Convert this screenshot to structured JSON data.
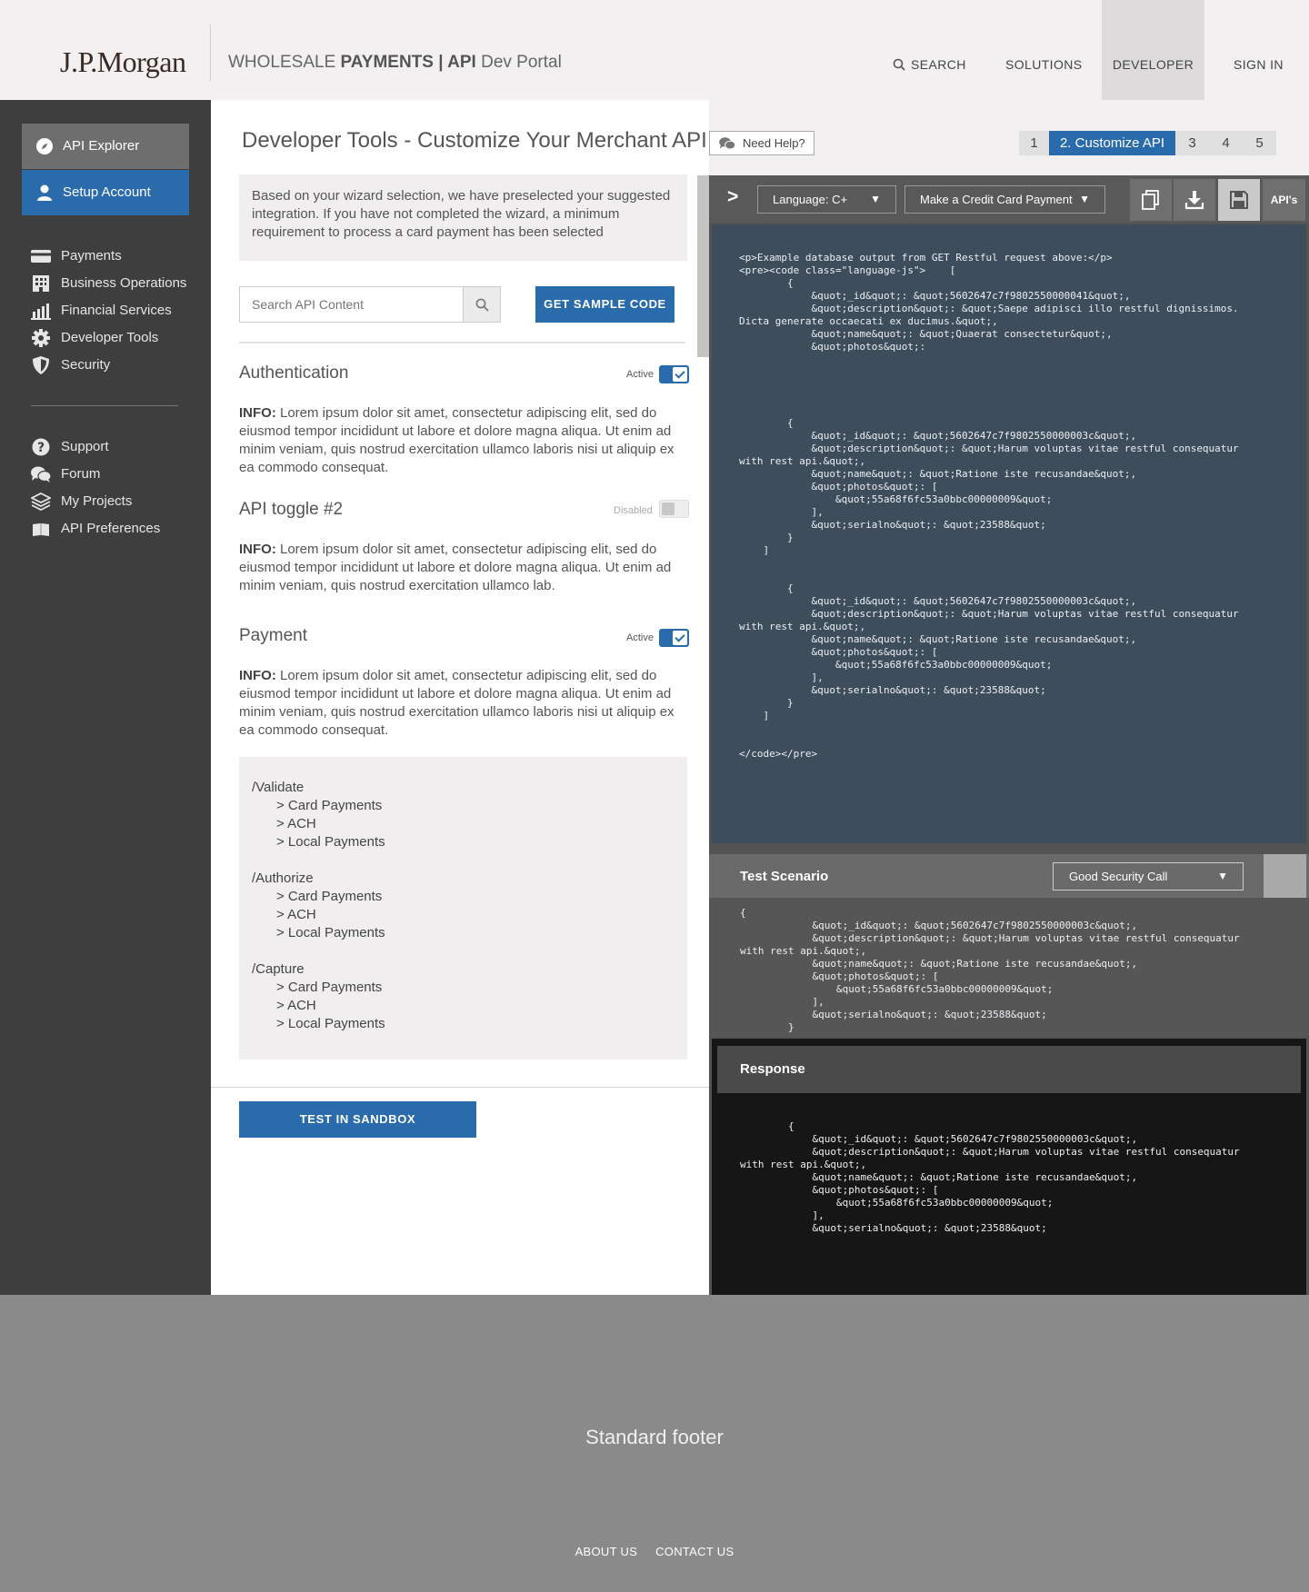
{
  "header": {
    "logo": "J.P.Morgan",
    "portal_pre": "WHOLESALE ",
    "portal_bold1": "PAYMENTS",
    "portal_sep": " | ",
    "portal_bold2": "API",
    "portal_post": " Dev Portal",
    "nav": {
      "search": "SEARCH",
      "solutions": "SOLUTIONS",
      "developer": "DEVELOPER",
      "signin": "SIGN IN"
    }
  },
  "sidebar": {
    "buttons": [
      {
        "label": "API Explorer",
        "icon": "compass-icon"
      },
      {
        "label": "Setup Account",
        "icon": "user-icon"
      }
    ],
    "items": [
      {
        "label": "Payments",
        "icon": "card-icon"
      },
      {
        "label": "Business Operations",
        "icon": "building-icon"
      },
      {
        "label": "Financial Services",
        "icon": "chart-icon"
      },
      {
        "label": "Developer Tools",
        "icon": "gear-icon"
      },
      {
        "label": "Security",
        "icon": "shield-icon"
      }
    ],
    "support_items": [
      {
        "label": "Support",
        "icon": "question-icon"
      },
      {
        "label": "Forum",
        "icon": "chat-icon"
      },
      {
        "label": "My Projects",
        "icon": "layers-icon"
      },
      {
        "label": "API Preferences",
        "icon": "book-icon"
      }
    ]
  },
  "main": {
    "title": "Developer Tools - Customize Your Merchant API",
    "intro": "Based on your wizard selection, we have preselected your suggested integration. If you have not completed the wizard, a minimum requirement to process a card payment has been selected",
    "search_placeholder": "Search API Content",
    "sample_button": "GET SAMPLE CODE",
    "sections": [
      {
        "title": "Authentication",
        "status": "Active",
        "info_label": "INFO:",
        "info": " Lorem ipsum dolor sit amet, consectetur adipiscing elit, sed do eiusmod tempor incididunt ut labore et dolore magna aliqua. Ut enim ad minim veniam, quis nostrud exercitation ullamco laboris nisi ut aliquip ex ea commodo consequat."
      },
      {
        "title": "API toggle #2",
        "status": "Disabled",
        "info_label": "INFO:",
        "info": " Lorem ipsum dolor sit amet, consectetur adipiscing elit, sed do eiusmod tempor incididunt ut labore et dolore magna aliqua. Ut enim ad minim veniam, quis nostrud exercitation ullamco lab."
      },
      {
        "title": "Payment",
        "status": "Active",
        "info_label": "INFO:",
        "info": " Lorem ipsum dolor sit amet, consectetur adipiscing elit, sed do eiusmod tempor incididunt ut labore et dolore magna aliqua. Ut enim ad minim veniam, quis nostrud exercitation ullamco laboris nisi ut aliquip ex ea commodo consequat."
      }
    ],
    "endpoints": [
      {
        "path": "/Validate",
        "items": [
          "> Card Payments",
          "> ACH",
          "> Local Payments"
        ]
      },
      {
        "path": "/Authorize",
        "items": [
          "> Card Payments",
          "> ACH",
          "> Local Payments"
        ]
      },
      {
        "path": "/Capture",
        "items": [
          "> Card Payments",
          "> ACH",
          "> Local Payments"
        ]
      }
    ],
    "sandbox_button": "TEST IN SANDBOX"
  },
  "right": {
    "help": "Need Help?",
    "steps": [
      {
        "label": "1",
        "width": 33
      },
      {
        "label": "2. Customize API",
        "width": 139,
        "active": true
      },
      {
        "label": "3",
        "width": 37
      },
      {
        "label": "4",
        "width": 37
      },
      {
        "label": "5",
        "width": 37
      }
    ],
    "toolbar": {
      "prompt": ">",
      "language": "Language: C+",
      "payment": "Make a Credit Card Payment",
      "apis": "API's"
    },
    "code": "<p>Example database output from GET Restful request above:</p>\n<pre><code class=\"language-js\">    [\n        {\n            &quot;_id&quot;: &quot;5602647c7f9802550000041&quot;,\n            &quot;description&quot;: &quot;Saepe adipisci illo restful dignissimos.\nDicta generate occaecati ex ducimus.&quot;,\n            &quot;name&quot;: &quot;Quaerat consectetur&quot;,\n            &quot;photos&quot;:\n\n\n\n\n\n        {\n            &quot;_id&quot;: &quot;5602647c7f9802550000003c&quot;,\n            &quot;description&quot;: &quot;Harum voluptas vitae restful consequatur\nwith rest api.&quot;,\n            &quot;name&quot;: &quot;Ratione iste recusandae&quot;,\n            &quot;photos&quot;: [\n                &quot;55a68f6fc53a0bbc00000009&quot;\n            ],\n            &quot;serialno&quot;: &quot;23588&quot;\n        }\n    ]\n\n\n        {\n            &quot;_id&quot;: &quot;5602647c7f9802550000003c&quot;,\n            &quot;description&quot;: &quot;Harum voluptas vitae restful consequatur\nwith rest api.&quot;,\n            &quot;name&quot;: &quot;Ratione iste recusandae&quot;,\n            &quot;photos&quot;: [\n                &quot;55a68f6fc53a0bbc00000009&quot;\n            ],\n            &quot;serialno&quot;: &quot;23588&quot;\n        }\n    ]\n\n\n</code></pre>",
    "scenario": {
      "title": "Test Scenario",
      "selected": "Good Security Call",
      "code": "{\n            &quot;_id&quot;: &quot;5602647c7f9802550000003c&quot;,\n            &quot;description&quot;: &quot;Harum voluptas vitae restful consequatur\nwith rest api.&quot;,\n            &quot;name&quot;: &quot;Ratione iste recusandae&quot;,\n            &quot;photos&quot;: [\n                &quot;55a68f6fc53a0bbc00000009&quot;\n            ],\n            &quot;serialno&quot;: &quot;23588&quot;\n        }"
    },
    "response": {
      "title": "Response",
      "code": "        {\n            &quot;_id&quot;: &quot;5602647c7f9802550000003c&quot;,\n            &quot;description&quot;: &quot;Harum voluptas vitae restful consequatur\nwith rest api.&quot;,\n            &quot;name&quot;: &quot;Ratione iste recusandae&quot;,\n            &quot;photos&quot;: [\n                &quot;55a68f6fc53a0bbc00000009&quot;\n            ],\n            &quot;serialno&quot;: &quot;23588&quot;"
    }
  },
  "footer": {
    "label": "Standard footer",
    "links": [
      "ABOUT US",
      "CONTACT US"
    ]
  },
  "colors": {
    "accent": "#2a6bab",
    "sidebar": "#3e3e3e",
    "code_bg": "#3d4d5c",
    "footer": "#8a8a8a"
  }
}
